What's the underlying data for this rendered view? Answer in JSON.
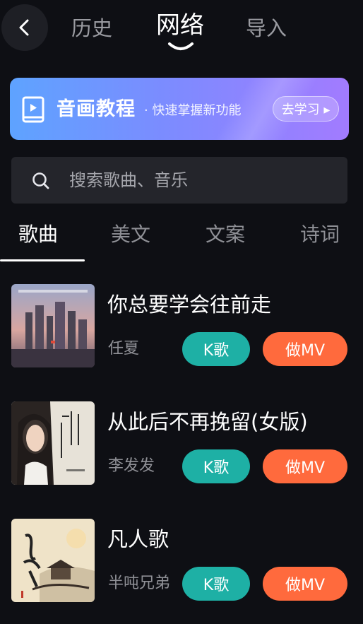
{
  "header": {
    "tabs": [
      {
        "label": "历史"
      },
      {
        "label": "网络"
      },
      {
        "label": "导入"
      }
    ],
    "active_tab": "网络"
  },
  "banner": {
    "title": "音画教程",
    "subtitle": "· 快速掌握新功能",
    "button_label": "去学习 ▸"
  },
  "search": {
    "placeholder": "搜索歌曲、音乐"
  },
  "categories": [
    {
      "label": "歌曲"
    },
    {
      "label": "美文"
    },
    {
      "label": "文案"
    },
    {
      "label": "诗词"
    }
  ],
  "active_category": "歌曲",
  "songs": [
    {
      "title": "你总要学会往前走",
      "artist": "任夏",
      "k_label": "K歌",
      "mv_label": "做MV"
    },
    {
      "title": "从此后不再挽留(女版)",
      "artist": "李发发",
      "k_label": "K歌",
      "mv_label": "做MV"
    },
    {
      "title": "凡人歌",
      "artist": "半吨兄弟",
      "k_label": "K歌",
      "mv_label": "做MV"
    }
  ],
  "colors": {
    "background": "#0e0f14",
    "k_button": "#1eb0a5",
    "mv_button": "#ff6a3d",
    "banner_start": "#5ea3ff",
    "banner_end": "#a27bff"
  }
}
